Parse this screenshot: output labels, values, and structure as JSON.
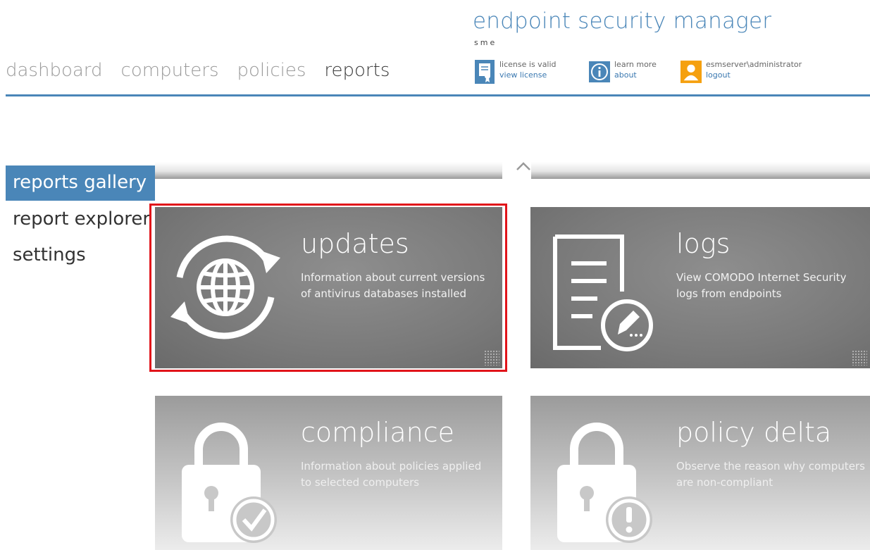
{
  "header": {
    "app_title": "endpoint security manager",
    "app_subtitle": "sme",
    "nav": [
      "dashboard",
      "computers",
      "policies",
      "reports"
    ],
    "active_nav": "reports",
    "license": {
      "line1": "license is valid",
      "link": "view license"
    },
    "help": {
      "line1": "learn more",
      "link": "about"
    },
    "user": {
      "line1": "esmserver\\administrator",
      "link": "logout"
    }
  },
  "sidebar": {
    "items": [
      {
        "label": "reports gallery",
        "active": true
      },
      {
        "label": "report explorer",
        "active": false
      },
      {
        "label": "settings",
        "active": false
      }
    ]
  },
  "tiles": [
    {
      "title": "updates",
      "description": "Information about current versions of antivirus databases installed",
      "icon": "globe-refresh-icon",
      "selected": true
    },
    {
      "title": "logs",
      "description": "View COMODO Internet Security logs from endpoints",
      "icon": "document-edit-icon",
      "selected": false
    },
    {
      "title": "compliance",
      "description": "Information about policies applied to selected computers",
      "icon": "lock-check-icon",
      "selected": false
    },
    {
      "title": "policy delta",
      "description": "Observe the reason why computers are non-compliant",
      "icon": "lock-alert-icon",
      "selected": false
    }
  ],
  "colors": {
    "accent": "#4a86b8",
    "selection": "#e1141a",
    "tile": "#7a7a7a",
    "license_icon": "#4a86b8",
    "user_icon": "#f5a00f"
  }
}
